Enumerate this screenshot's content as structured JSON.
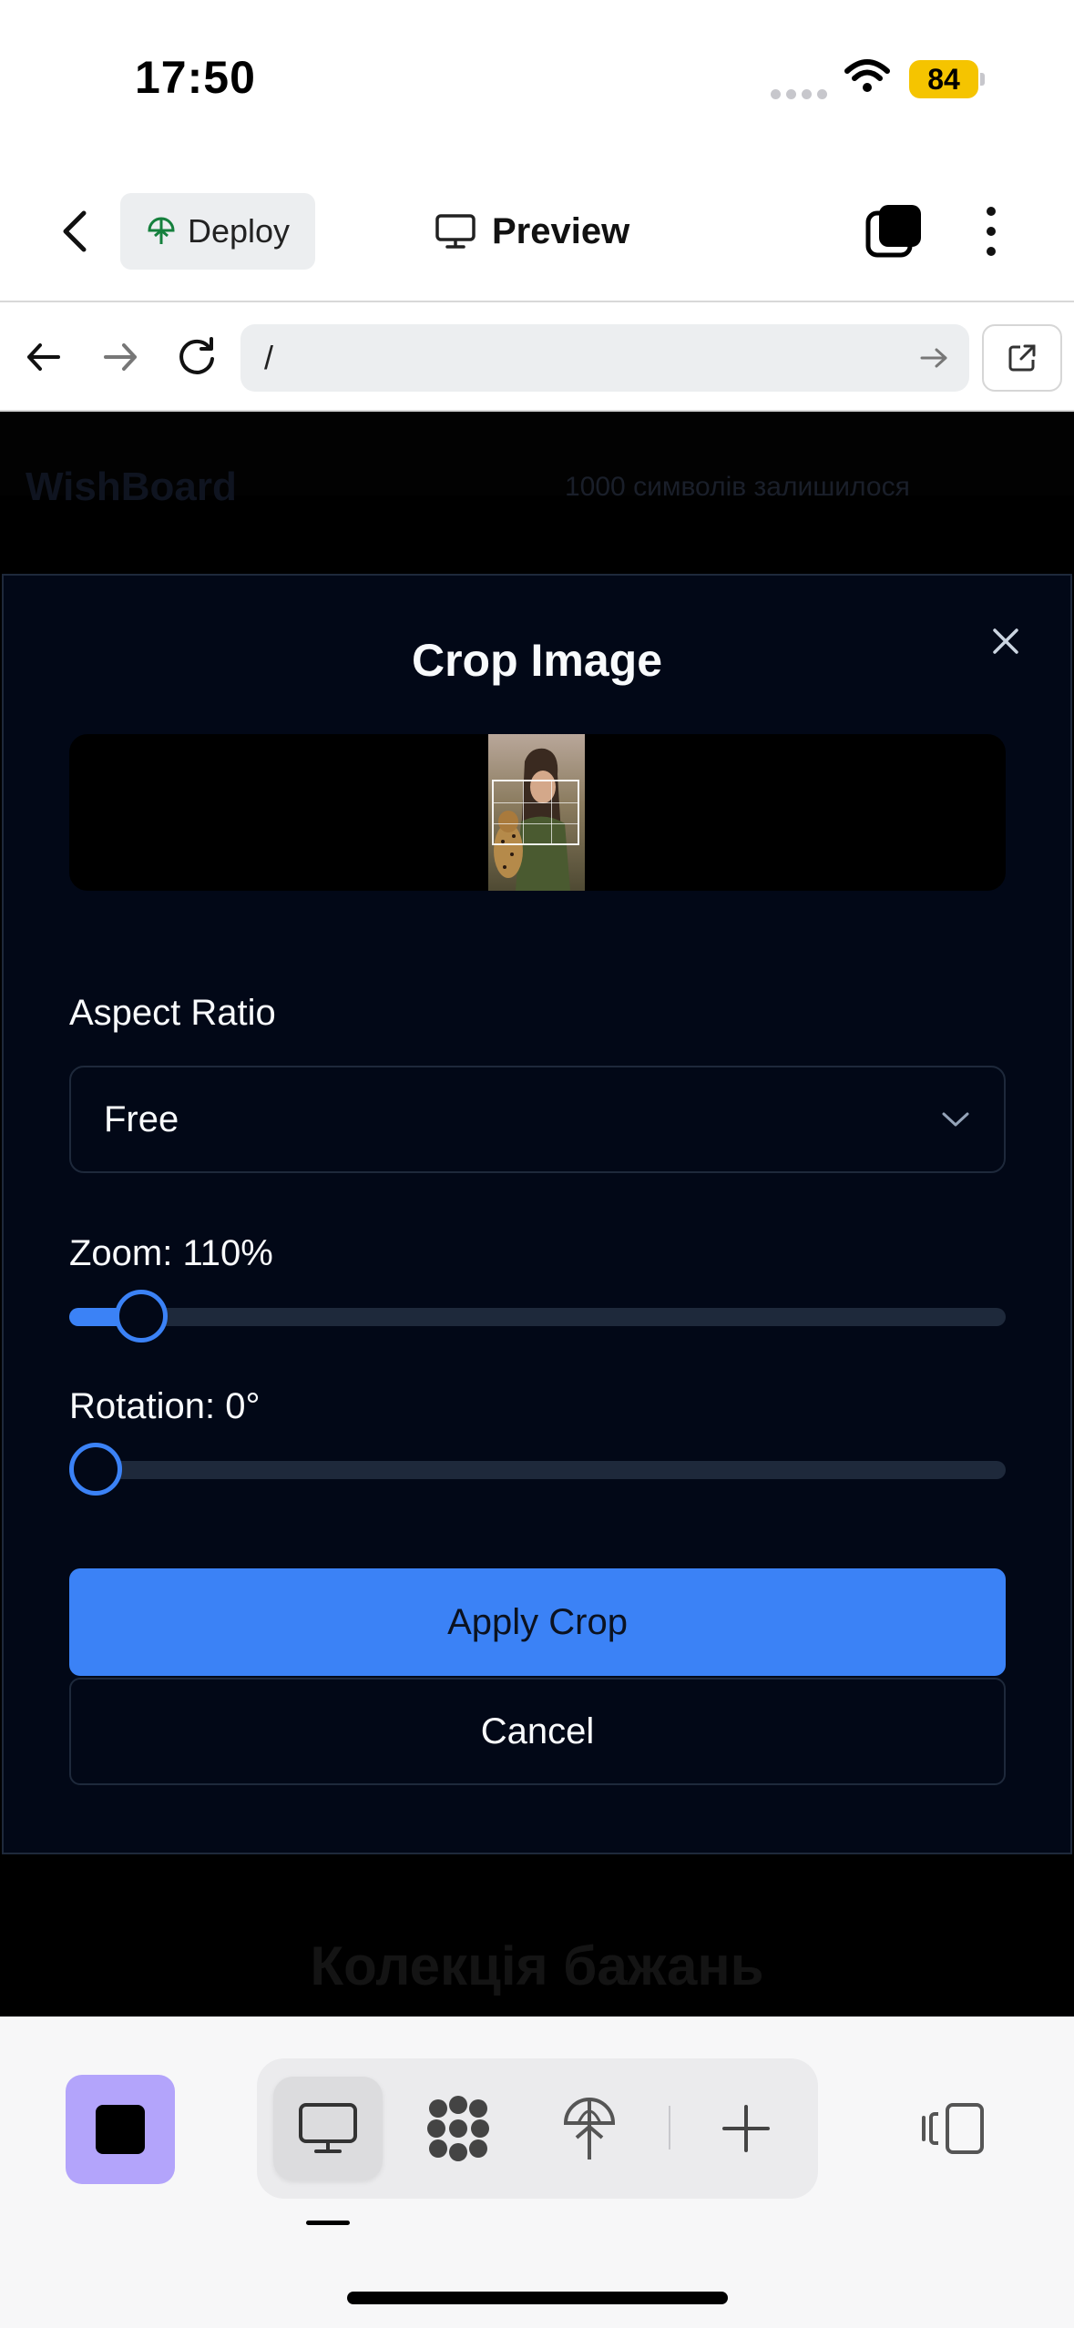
{
  "status_bar": {
    "time": "17:50",
    "battery": "84"
  },
  "nav": {
    "deploy_label": "Deploy",
    "preview_label": "Preview"
  },
  "browser": {
    "url": "/"
  },
  "background_app": {
    "logo": "WishBoard",
    "char_count": "1000 символів залишилося",
    "heading": "Колекція бажань"
  },
  "modal": {
    "title": "Crop Image",
    "aspect_ratio_label": "Aspect Ratio",
    "aspect_ratio_value": "Free",
    "zoom_label": "Zoom: 110%",
    "zoom_value": 110,
    "rotation_label": "Rotation: 0°",
    "rotation_value": 0,
    "apply_label": "Apply Crop",
    "cancel_label": "Cancel"
  },
  "colors": {
    "accent": "#3b82f6",
    "modal_bg": "#020817",
    "border": "#1e293b",
    "stop_button": "#b3a4fb"
  },
  "icons": {
    "back": "chevron-left-icon",
    "deploy": "globe-tree-icon",
    "preview": "monitor-icon",
    "tabs": "tabs-icon",
    "more": "vertical-dots-icon",
    "nav_back": "arrow-left-icon",
    "nav_forward": "arrow-right-icon",
    "reload": "reload-icon",
    "go": "arrow-right-icon",
    "open_external": "external-link-icon",
    "close": "close-icon",
    "dropdown": "chevron-down-icon",
    "stop": "stop-icon",
    "desktop": "monitor-icon",
    "integrations": "grid-circles-icon",
    "deploy_tool": "globe-tree-icon",
    "add": "plus-icon",
    "panel": "panel-toggle-icon"
  }
}
